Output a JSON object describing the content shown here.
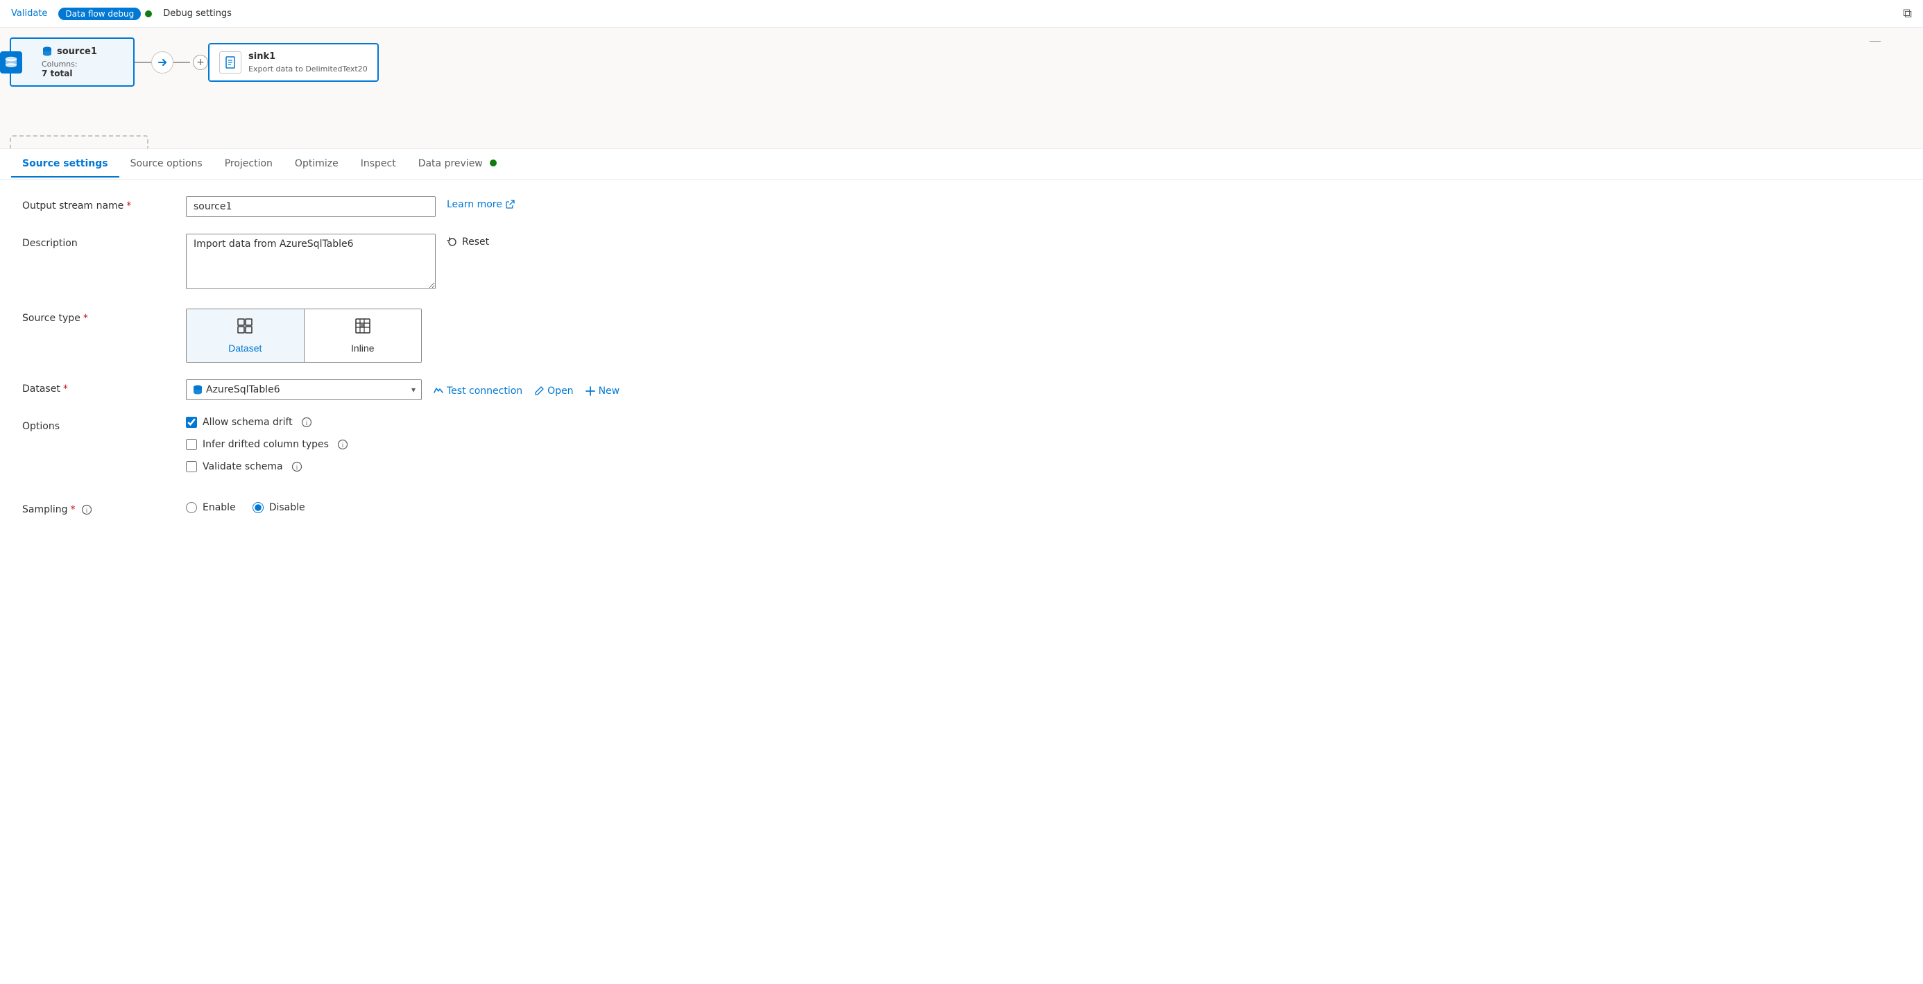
{
  "topbar": {
    "validate_label": "Validate",
    "debug_label": "Data flow debug",
    "debug_status": "●",
    "debug_settings_label": "Debug settings"
  },
  "canvas": {
    "source_node": {
      "name": "source1",
      "columns_label": "Columns:",
      "columns_count": "7 total"
    },
    "sink_node": {
      "name": "sink1",
      "subtitle": "Export data to DelimitedText20"
    }
  },
  "tabs": [
    {
      "id": "source-settings",
      "label": "Source settings",
      "active": true
    },
    {
      "id": "source-options",
      "label": "Source options",
      "active": false
    },
    {
      "id": "projection",
      "label": "Projection",
      "active": false
    },
    {
      "id": "optimize",
      "label": "Optimize",
      "active": false
    },
    {
      "id": "inspect",
      "label": "Inspect",
      "active": false
    },
    {
      "id": "data-preview",
      "label": "Data preview",
      "active": false,
      "dot": true
    }
  ],
  "form": {
    "output_stream_name_label": "Output stream name",
    "output_stream_name_value": "source1",
    "description_label": "Description",
    "description_value": "Import data from AzureSqlTable6",
    "source_type_label": "Source type",
    "source_type_options": [
      {
        "id": "dataset",
        "label": "Dataset",
        "selected": true
      },
      {
        "id": "inline",
        "label": "Inline",
        "selected": false
      }
    ],
    "dataset_label": "Dataset",
    "dataset_value": "AzureSqlTable6",
    "learn_more_label": "Learn more",
    "reset_label": "Reset",
    "test_connection_label": "Test connection",
    "open_label": "Open",
    "new_label": "New",
    "options_label": "Options",
    "allow_schema_drift_label": "Allow schema drift",
    "allow_schema_drift_checked": true,
    "infer_drifted_label": "Infer drifted column types",
    "infer_drifted_checked": false,
    "validate_schema_label": "Validate schema",
    "validate_schema_checked": false,
    "sampling_label": "Sampling",
    "sampling_enable_label": "Enable",
    "sampling_disable_label": "Disable",
    "sampling_disable_selected": true
  },
  "icons": {
    "table_grid": "⊞",
    "inline_grid": "▦",
    "chevron_down": "▾",
    "external_link": "↗",
    "reset_circle": "↺",
    "test_connection": "⚡",
    "pencil": "✎",
    "plus": "+",
    "source_cylinder": "🗄",
    "sink_file": "📄"
  }
}
